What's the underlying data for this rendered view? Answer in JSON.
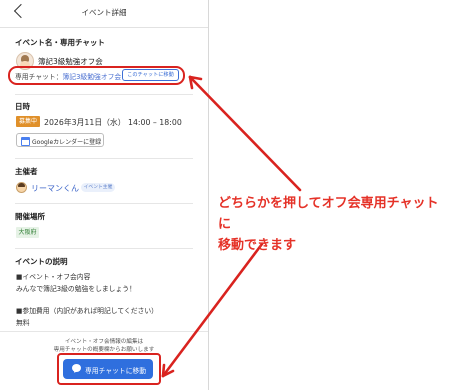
{
  "header": {
    "title": "イベント詳細"
  },
  "event": {
    "section_title": "イベント名・専用チャット",
    "name": "簿記3級勉強オフ会",
    "chat_prefix": "専用チャット：",
    "chat_name": "簿記3級勉強オフ会",
    "chat_link_button": "このチャットに移動"
  },
  "datetime": {
    "section_title": "日時",
    "status_badge": "募集中",
    "date": "2026年3月11日（水） 14:00 – 18:00",
    "calendar_button": "Googleカレンダーに登録"
  },
  "organizer": {
    "section_title": "主催者",
    "name": "リーマンくん",
    "badge": "イベント主催"
  },
  "venue": {
    "section_title": "開催場所",
    "place": "大阪府"
  },
  "description": {
    "section_title": "イベントの説明",
    "lines": [
      "■イベント・オフ会内容",
      "みんなで簿記3級の勉強をしましょう！",
      "■参加費用（内訳があれば明記してください）",
      "無料"
    ]
  },
  "footer": {
    "note_line1": "イベント・オフ会情報の編集は",
    "note_line2": "専用チャットの概要欄からお願いします",
    "chat_button": "専用チャットに移動"
  },
  "annotation": {
    "line1": "どちらかを押してオフ会専用チャットに",
    "line2": "移動できます",
    "color": "#e53228"
  }
}
